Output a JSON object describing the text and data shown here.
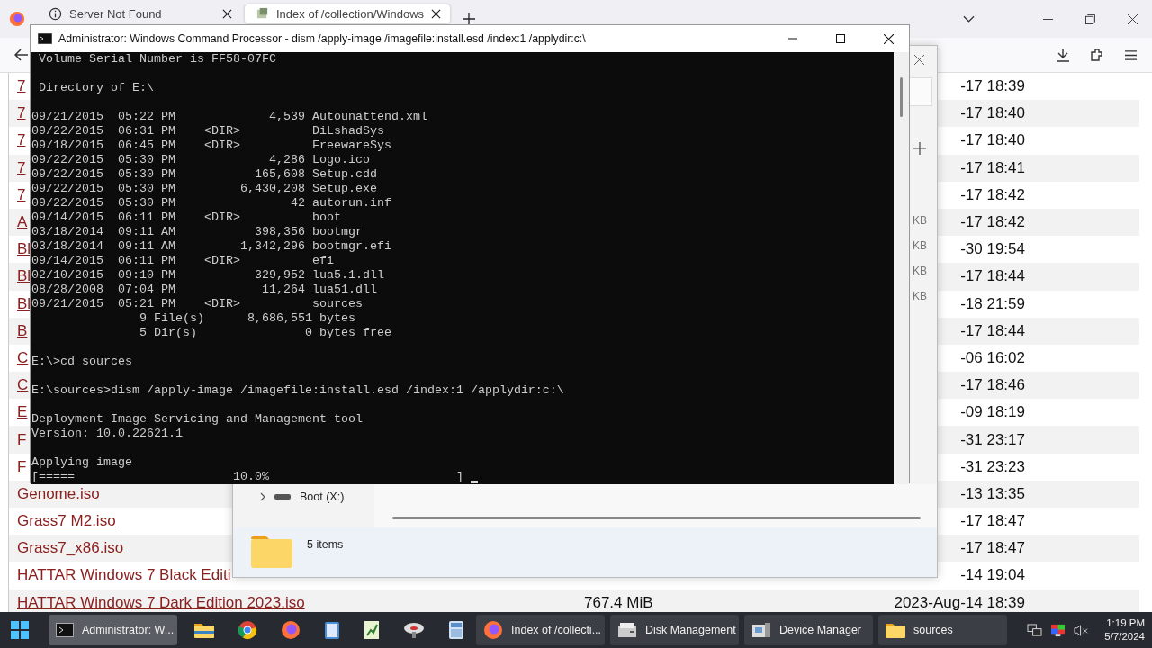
{
  "browser": {
    "tabs": [
      {
        "label": "Server Not Found",
        "selected": false
      },
      {
        "label": "Index of /collection/Windows",
        "selected": true
      }
    ],
    "listing": [
      {
        "name": "7",
        "date": "-17 18:39"
      },
      {
        "name": "7",
        "date": "-17 18:40"
      },
      {
        "name": "7",
        "date": "-17 18:40"
      },
      {
        "name": "7",
        "date": "-17 18:41"
      },
      {
        "name": "7",
        "date": "-17 18:42"
      },
      {
        "name": "A",
        "date": "-17 18:42"
      },
      {
        "name": "Bl",
        "date": "-30 19:54"
      },
      {
        "name": "Bl",
        "date": "-17 18:44"
      },
      {
        "name": "Bl",
        "date": "-18 21:59"
      },
      {
        "name": "B",
        "date": "-17 18:44"
      },
      {
        "name": "C",
        "date": "-06 16:02"
      },
      {
        "name": "C",
        "date": "-17 18:46"
      },
      {
        "name": "E",
        "date": "-09 18:19"
      },
      {
        "name": "F",
        "date": "-31 23:17"
      },
      {
        "name": "F",
        "date": "-31 23:23"
      },
      {
        "name": "Genome.iso",
        "date": "-13 13:35"
      },
      {
        "name": "Grass7 M2.iso",
        "date": "-17 18:47"
      },
      {
        "name": "Grass7_x86.iso",
        "date": "-17 18:47"
      },
      {
        "name": "HATTAR Windows 7 Black Editi",
        "date": "-14 19:04"
      },
      {
        "name": "HATTAR Windows 7 Dark Edition 2023.iso",
        "size": "767.4 MiB",
        "date": "2023-Aug-14 18:39"
      }
    ]
  },
  "explorer": {
    "size_labels": [
      "KB",
      "KB",
      "KB",
      "KB"
    ],
    "tree_item": "Boot (X:)",
    "status": "5 items"
  },
  "console": {
    "title": "Administrator: Windows Command Processor - dism  /apply-image /imagefile:install.esd /index:1 /applydir:c:\\",
    "blocks": [
      [
        " Volume Serial Number is FF58-07FC"
      ],
      [
        " Directory of E:\\"
      ],
      [
        "09/21/2015  05:22 PM             4,539 Autounattend.xml",
        "09/22/2015  06:31 PM    <DIR>          DiLshadSys",
        "09/18/2015  06:45 PM    <DIR>          FreewareSys",
        "09/22/2015  05:30 PM             4,286 Logo.ico",
        "09/22/2015  05:30 PM           165,608 Setup.cdd",
        "09/22/2015  05:30 PM         6,430,208 Setup.exe",
        "09/22/2015  05:30 PM                42 autorun.inf",
        "09/14/2015  06:11 PM    <DIR>          boot",
        "03/18/2014  09:11 AM           398,356 bootmgr",
        "03/18/2014  09:11 AM         1,342,296 bootmgr.efi",
        "09/14/2015  06:11 PM    <DIR>          efi",
        "02/10/2015  09:10 PM           329,952 lua5.1.dll",
        "08/28/2008  07:04 PM            11,264 lua51.dll",
        "09/21/2015  05:21 PM    <DIR>          sources",
        "               9 File(s)      8,686,551 bytes",
        "               5 Dir(s)               0 bytes free"
      ],
      [
        "E:\\>cd sources"
      ],
      [
        "E:\\sources>dism /apply-image /imagefile:install.esd /index:1 /applydir:c:\\"
      ],
      [
        "Deployment Image Servicing and Management tool",
        "Version: 10.0.22621.1"
      ],
      [
        "Applying image",
        "[=====                      10.0%                          ]"
      ]
    ]
  },
  "taskbar": {
    "windows": [
      {
        "label": "Administrator: W...",
        "selected": true
      },
      {
        "label": "Index of /collecti...",
        "selected": false
      },
      {
        "label": "Disk Management",
        "selected": false
      },
      {
        "label": "Device Manager",
        "selected": false
      },
      {
        "label": "sources",
        "selected": false
      }
    ],
    "time": "1:19 PM",
    "date": "5/7/2024"
  }
}
